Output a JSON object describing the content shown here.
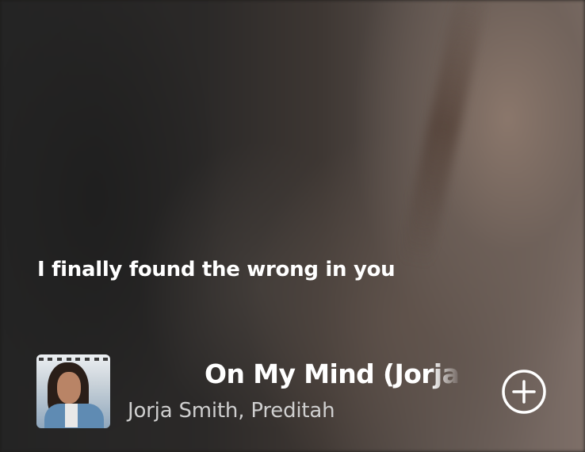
{
  "lyric": {
    "current_line": "I finally found the wrong in you"
  },
  "track": {
    "title": "On My Mind (Jorja Smith X Preditah)",
    "artists": "Jorja Smith, Preditah",
    "cover_icon": "album-cover"
  },
  "actions": {
    "add_icon": "plus-circle-icon"
  },
  "colors": {
    "text_primary": "#ffffff",
    "text_secondary": "#cfcfcf"
  }
}
